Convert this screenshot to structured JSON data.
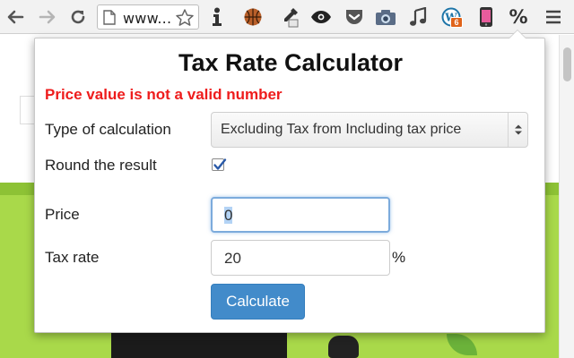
{
  "browser": {
    "omnibox_text": "www...",
    "extension_percent": "%",
    "wordpress_badge": "6"
  },
  "popup": {
    "title": "Tax Rate Calculator",
    "error": "Price value is not a valid number",
    "type_label": "Type of calculation",
    "type_value": "Excluding Tax from Including tax price",
    "round_label": "Round the result",
    "round_checked": true,
    "price_label": "Price",
    "price_value": "0",
    "tax_label": "Tax rate",
    "tax_value": "20",
    "tax_unit": "%",
    "calculate_label": "Calculate"
  },
  "colors": {
    "error": "#ee1c1c",
    "button": "#428bca",
    "page_green": "#a9d94a"
  }
}
